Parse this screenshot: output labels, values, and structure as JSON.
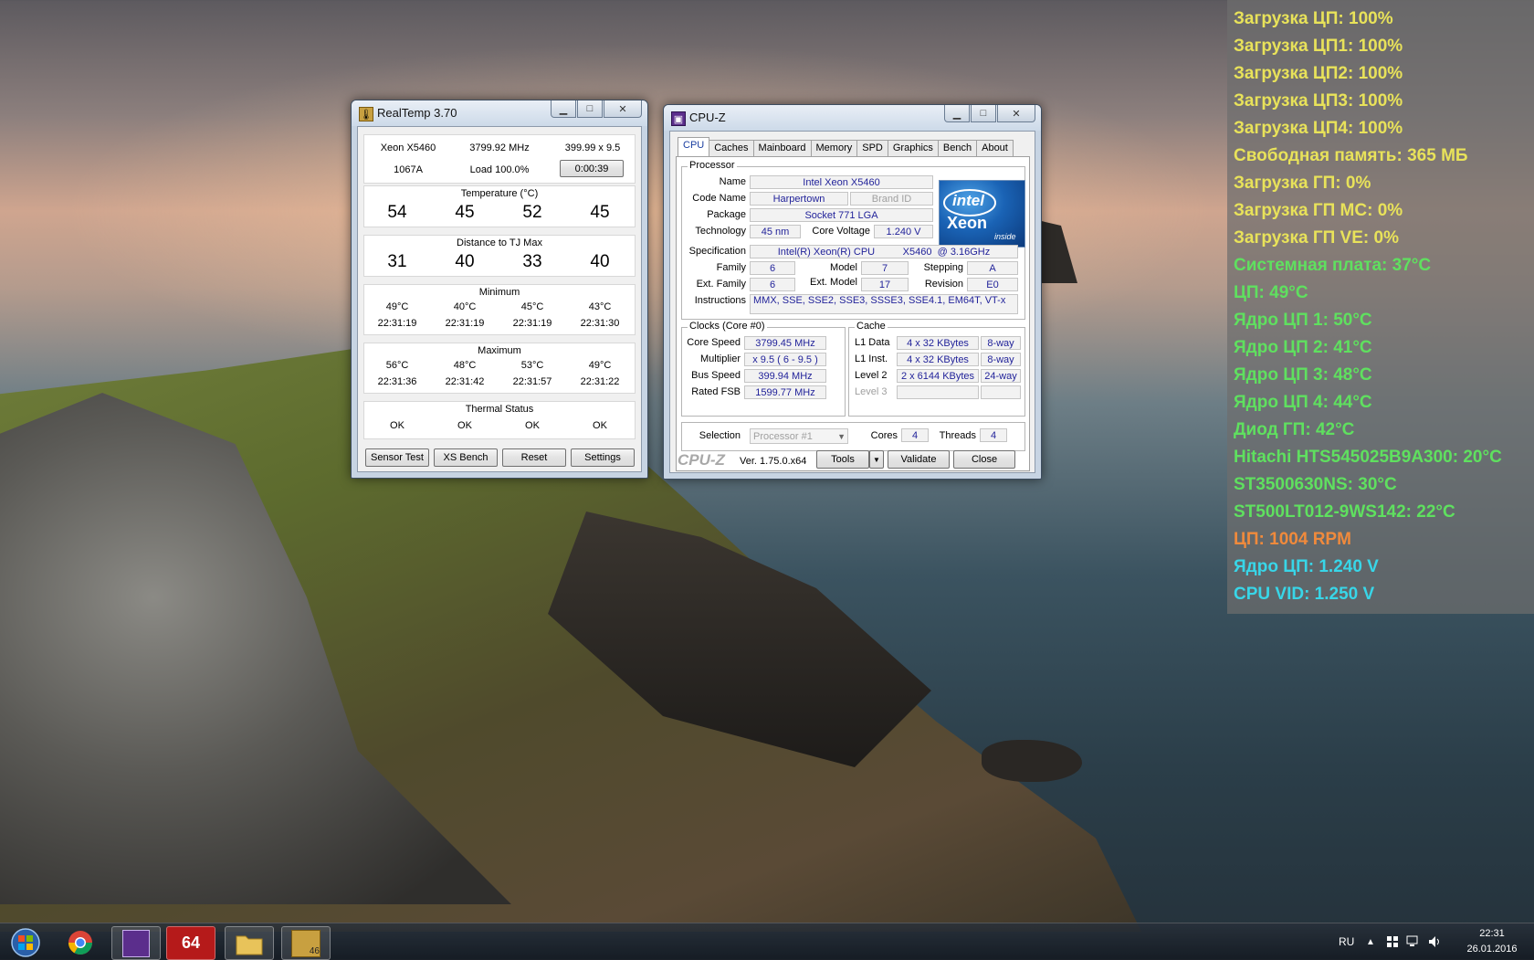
{
  "realtemp": {
    "title": "RealTemp 3.70",
    "window_buttons": {
      "minimize": "▁",
      "maximize": "□",
      "close": "✕"
    },
    "cpu": "Xeon X5460",
    "freq": "3799.92 MHz",
    "mult": "399.99 x 9.5",
    "vid": "1067A",
    "load": "Load 100.0%",
    "timer": "0:00:39",
    "temperature_label": "Temperature (°C)",
    "temperatures": [
      "54",
      "45",
      "52",
      "45"
    ],
    "distance_label": "Distance to TJ Max",
    "distances": [
      "31",
      "40",
      "33",
      "40"
    ],
    "minimum_label": "Minimum",
    "minimum_temps": [
      "49°C",
      "40°C",
      "45°C",
      "43°C"
    ],
    "minimum_times": [
      "22:31:19",
      "22:31:19",
      "22:31:19",
      "22:31:30"
    ],
    "maximum_label": "Maximum",
    "maximum_temps": [
      "56°C",
      "48°C",
      "53°C",
      "49°C"
    ],
    "maximum_times": [
      "22:31:36",
      "22:31:42",
      "22:31:57",
      "22:31:22"
    ],
    "thermal_label": "Thermal Status",
    "thermal_status": [
      "OK",
      "OK",
      "OK",
      "OK"
    ],
    "buttons": {
      "sensor_test": "Sensor Test",
      "xs_bench": "XS Bench",
      "reset": "Reset",
      "settings": "Settings"
    }
  },
  "cpuz": {
    "title": "CPU-Z",
    "window_buttons": {
      "minimize": "▁",
      "maximize": "□",
      "close": "✕"
    },
    "tabs": [
      "CPU",
      "Caches",
      "Mainboard",
      "Memory",
      "SPD",
      "Graphics",
      "Bench",
      "About"
    ],
    "processor_label": "Processor",
    "labels": {
      "name": "Name",
      "code_name": "Code Name",
      "brand_id": "Brand ID",
      "package": "Package",
      "technology": "Technology",
      "core_voltage": "Core Voltage",
      "specification": "Specification",
      "family": "Family",
      "model": "Model",
      "stepping": "Stepping",
      "ext_family": "Ext. Family",
      "ext_model": "Ext. Model",
      "revision": "Revision",
      "instructions": "Instructions"
    },
    "values": {
      "name": "Intel Xeon X5460",
      "code_name": "Harpertown",
      "package": "Socket 771 LGA",
      "technology": "45 nm",
      "core_voltage": "1.240 V",
      "specification": "Intel(R) Xeon(R) CPU          X5460  @ 3.16GHz",
      "family": "6",
      "model": "7",
      "stepping": "A",
      "ext_family": "6",
      "ext_model": "17",
      "revision": "E0",
      "instructions": "MMX, SSE, SSE2, SSE3, SSSE3, SSE4.1, EM64T, VT-x"
    },
    "logo": {
      "brand": "intel",
      "product": "Xeon",
      "tag": "inside"
    },
    "clocks_label": "Clocks (Core #0)",
    "clocks": {
      "core_speed_label": "Core Speed",
      "core_speed": "3799.45 MHz",
      "multiplier_label": "Multiplier",
      "multiplier": "x 9.5 ( 6 - 9.5 )",
      "bus_speed_label": "Bus Speed",
      "bus_speed": "399.94 MHz",
      "rated_fsb_label": "Rated FSB",
      "rated_fsb": "1599.77 MHz"
    },
    "cache_label": "Cache",
    "cache": {
      "l1d_label": "L1 Data",
      "l1d": "4 x 32 KBytes",
      "l1d_way": "8-way",
      "l1i_label": "L1 Inst.",
      "l1i": "4 x 32 KBytes",
      "l1i_way": "8-way",
      "l2_label": "Level 2",
      "l2": "2 x 6144 KBytes",
      "l2_way": "24-way",
      "l3_label": "Level 3"
    },
    "selection_label": "Selection",
    "selection": "Processor #1",
    "cores_label": "Cores",
    "cores": "4",
    "threads_label": "Threads",
    "threads": "4",
    "footer_logo": "CPU-Z",
    "version": "Ver. 1.75.0.x64",
    "buttons": {
      "tools": "Tools",
      "validate": "Validate",
      "close": "Close"
    }
  },
  "overlay": {
    "lines": [
      {
        "text": "Загрузка ЦП: 100%",
        "color": "#e8e25a"
      },
      {
        "text": "Загрузка ЦП1: 100%",
        "color": "#e8e25a"
      },
      {
        "text": "Загрузка ЦП2: 100%",
        "color": "#e8e25a"
      },
      {
        "text": "Загрузка ЦП3: 100%",
        "color": "#e8e25a"
      },
      {
        "text": "Загрузка ЦП4: 100%",
        "color": "#e8e25a"
      },
      {
        "text": "Свободная память: 365 МБ",
        "color": "#e8e25a"
      },
      {
        "text": "Загрузка ГП: 0%",
        "color": "#e8e25a"
      },
      {
        "text": "Загрузка ГП MC: 0%",
        "color": "#e8e25a"
      },
      {
        "text": "Загрузка ГП VE: 0%",
        "color": "#e8e25a"
      },
      {
        "text": "Системная плата: 37°C",
        "color": "#5fe05f"
      },
      {
        "text": "ЦП: 49°C",
        "color": "#5fe05f"
      },
      {
        "text": "Ядро ЦП 1: 50°C",
        "color": "#5fe05f"
      },
      {
        "text": "Ядро ЦП 2: 41°C",
        "color": "#5fe05f"
      },
      {
        "text": "Ядро ЦП 3: 48°C",
        "color": "#5fe05f"
      },
      {
        "text": "Ядро ЦП 4: 44°C",
        "color": "#5fe05f"
      },
      {
        "text": "Диод ГП: 42°C",
        "color": "#5fe05f"
      },
      {
        "text": "Hitachi HTS545025B9A300: 20°C",
        "color": "#5fe05f"
      },
      {
        "text": "ST3500630NS: 30°C",
        "color": "#5fe05f"
      },
      {
        "text": "ST500LT012-9WS142: 22°C",
        "color": "#5fe05f"
      },
      {
        "text": "ЦП: 1004 RPM",
        "color": "#f08a3c"
      },
      {
        "text": "Ядро ЦП: 1.240 V",
        "color": "#38d6e8"
      },
      {
        "text": "CPU VID: 1.250 V",
        "color": "#38d6e8"
      }
    ]
  },
  "taskbar": {
    "items": [
      {
        "name": "start-button",
        "icon": "windows-orb-icon"
      },
      {
        "name": "chrome-taskbar-button",
        "icon": "chrome-icon"
      },
      {
        "name": "cpuz-taskbar-button",
        "icon": "cpuz-icon"
      },
      {
        "name": "aida64-taskbar-button",
        "icon": "aida64-icon",
        "text": "64"
      },
      {
        "name": "explorer-taskbar-button",
        "icon": "folder-icon"
      },
      {
        "name": "realtemp-taskbar-button",
        "icon": "realtemp-icon",
        "text": "46"
      }
    ],
    "language": "RU",
    "time": "22:31",
    "date": "26.01.2016"
  }
}
